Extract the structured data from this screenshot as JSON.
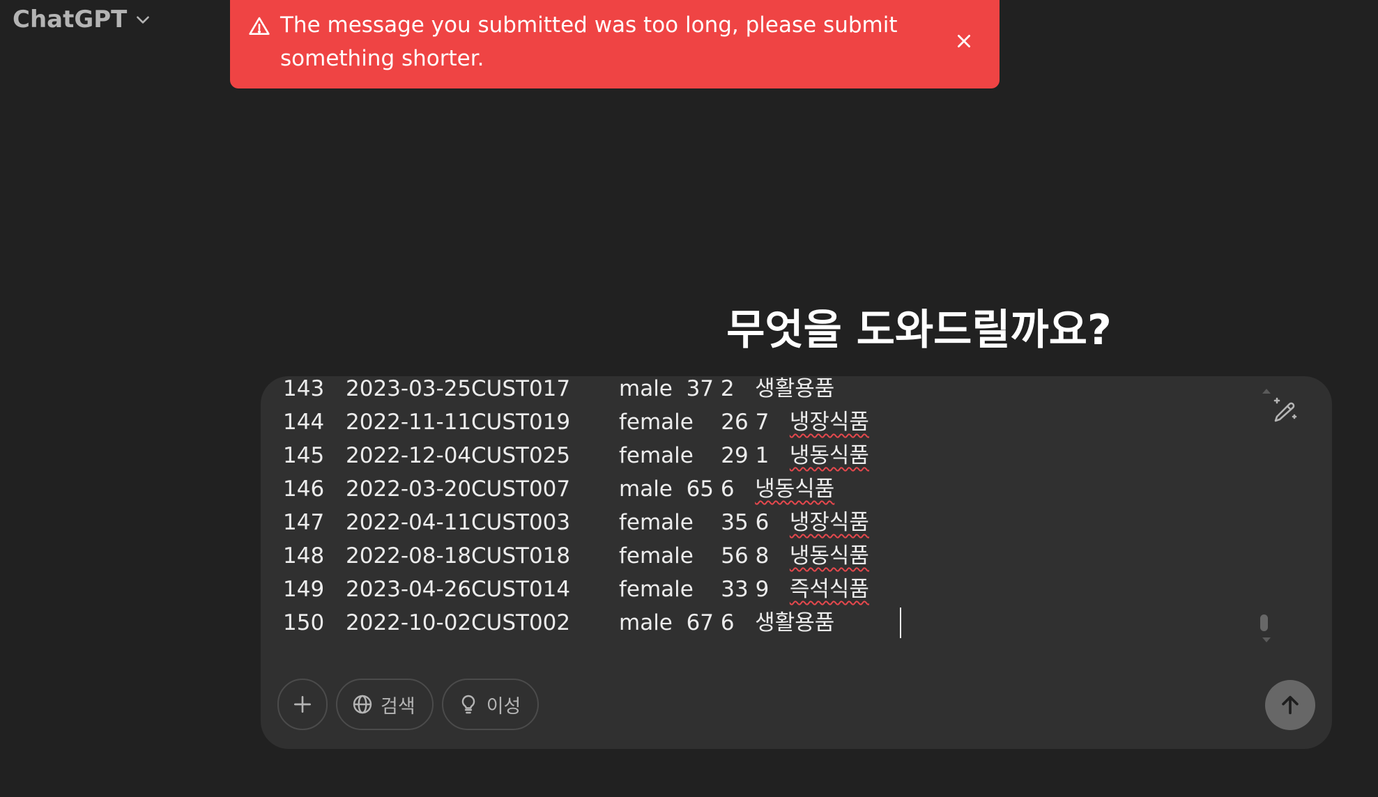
{
  "header": {
    "model_name": "ChatGPT"
  },
  "toast": {
    "message": "The message you submitted was too long, please submit something shorter."
  },
  "heading": "무엇을 도와드릴까요?",
  "composer": {
    "rows": [
      {
        "idx": "143",
        "date": "2023-03-25",
        "cust": "CUST017",
        "rest": "male  37 2   생활용품"
      },
      {
        "idx": "144",
        "date": "2022-11-11",
        "cust": "CUST019",
        "rest": "female    26 7   ",
        "cat": "냉장식품"
      },
      {
        "idx": "145",
        "date": "2022-12-04",
        "cust": "CUST025",
        "rest": "female    29 1   ",
        "cat": "냉동식품"
      },
      {
        "idx": "146",
        "date": "2022-03-20",
        "cust": "CUST007",
        "rest": "male  65 6   ",
        "cat": "냉동식품"
      },
      {
        "idx": "147",
        "date": "2022-04-11",
        "cust": "CUST003",
        "rest": "female    35 6   ",
        "cat": "냉장식품"
      },
      {
        "idx": "148",
        "date": "2022-08-18",
        "cust": "CUST018",
        "rest": "female    56 8   ",
        "cat": "냉동식품"
      },
      {
        "idx": "149",
        "date": "2023-04-26",
        "cust": "CUST014",
        "rest": "female    33 9   ",
        "cat": "즉석식품"
      },
      {
        "idx": "150",
        "date": "2022-10-02",
        "cust": "CUST002",
        "rest": "male  67 6   생활용품"
      }
    ]
  },
  "tools": {
    "search_label": "검색",
    "reason_label": "이성"
  },
  "icons": [
    "chevron-down-icon",
    "warning-icon",
    "close-icon",
    "edit-icon",
    "plus-icon",
    "globe-icon",
    "lightbulb-icon",
    "arrow-up-icon"
  ],
  "colors": {
    "background": "#212121",
    "toast": "#ef4444",
    "composer": "#303030",
    "send_button": "#676767"
  }
}
